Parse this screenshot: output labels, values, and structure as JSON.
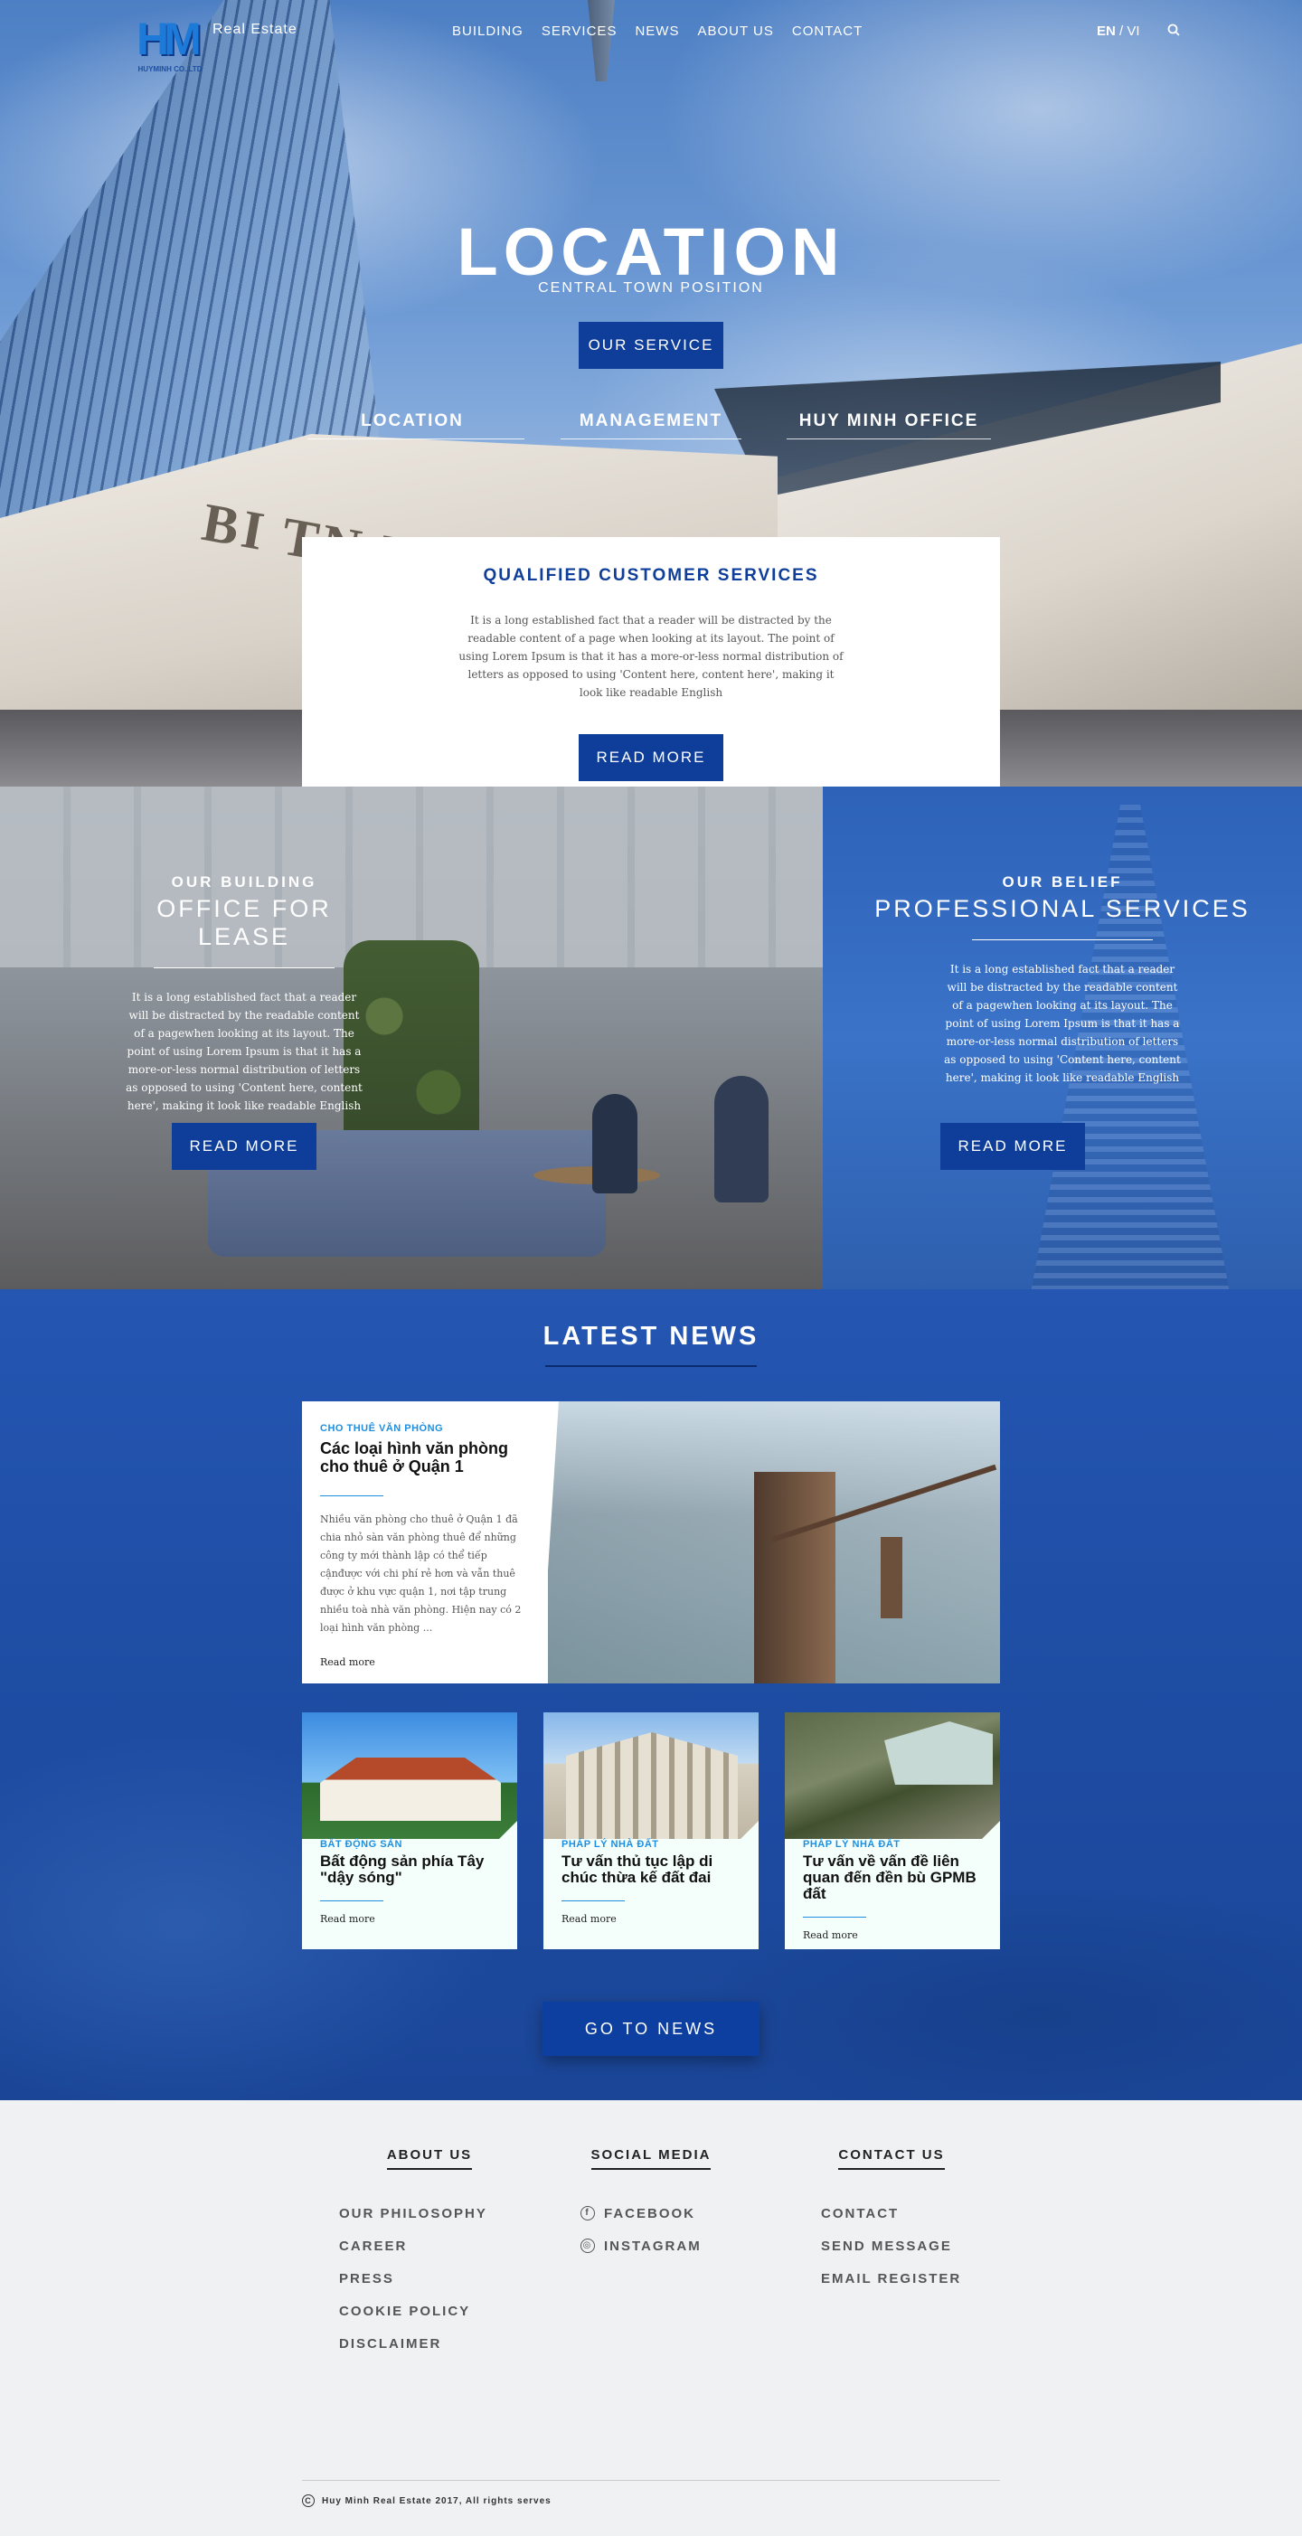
{
  "header": {
    "brand": "Real Estate",
    "logo_text": "HUYMINH CO.,LTD",
    "nav": [
      "BUILDING",
      "SERVICES",
      "NEWS",
      "ABOUT US",
      "CONTACT"
    ],
    "lang_en": "EN",
    "lang_sep": " / ",
    "lang_vi": "VI"
  },
  "hero": {
    "title": "LOCATION",
    "subtitle": "CENTRAL TOWN POSITION",
    "button": "OUR SERVICE",
    "tabs": [
      "LOCATION",
      "MANAGEMENT",
      "HUY MINH OFFICE"
    ],
    "building_sign": "BI TN TOV"
  },
  "qualified": {
    "title": "QUALIFIED CUSTOMER SERVICES",
    "body": "It is a long established fact that a reader will be distracted by the readable content of a page when looking at its layout. The point of using Lorem Ipsum is that it has a more-or-less normal distribution of letters as opposed to using 'Content here, content here', making it look like readable English",
    "button": "READ MORE"
  },
  "features": {
    "left": {
      "kicker": "OUR BUILDING",
      "title": "OFFICE FOR LEASE",
      "body": "It is a long established fact that a reader will be distracted by the readable content of a pagewhen looking at its layout. The point of using Lorem Ipsum is that it has a more-or-less normal distribution of letters as opposed to using 'Content here, content here', making it look like readable English",
      "button": "READ MORE"
    },
    "right": {
      "kicker": "OUR BELIEF",
      "title": "PROFESSIONAL SERVICES",
      "body": "It is a long established fact that a reader will be distracted by the readable content of a pagewhen looking at its layout. The point of using Lorem Ipsum is that it has a more-or-less normal distribution of letters as opposed to using 'Content here, content here', making it look like readable English",
      "button": "READ MORE"
    }
  },
  "news": {
    "title": "LATEST NEWS",
    "featured": {
      "category": "CHO THUÊ VĂN PHÒNG",
      "headline": "Các loại hình văn phòng cho thuê ở Quận 1",
      "excerpt": "Nhiều văn phòng cho thuê ở Quận 1 đã chia nhỏ sàn văn phòng thuê để những công ty mới thành lập có thể tiếp cậnđược với chi phí rẻ hơn và vẫn thuê được ở khu vực quận 1, nơi tập trung nhiều toà nhà văn phòng. Hiện nay có 2 loại hình văn phòng ...",
      "read_more": "Read more"
    },
    "cards": [
      {
        "category": "BẤT ĐỘNG SẢN",
        "headline": "Bất động sản phía Tây \"dậy sóng\"",
        "read_more": "Read more"
      },
      {
        "category": "PHÁP LÝ NHÀ ĐẤT",
        "headline": "Tư vấn thủ tục lập di chúc thừa kế đất đai",
        "read_more": "Read more"
      },
      {
        "category": "PHÁP LÝ NHÀ ĐẤT",
        "headline": "Tư vấn về vấn đề liên quan đến đền bù GPMB đất",
        "read_more": "Read more"
      }
    ],
    "button": "GO TO NEWS"
  },
  "footer": {
    "about": {
      "title": "ABOUT US",
      "items": [
        "OUR PHILOSOPHY",
        "CAREER",
        "PRESS",
        "COOKIE POLICY",
        "DISCLAIMER"
      ]
    },
    "social": {
      "title": "SOCIAL MEDIA",
      "items": [
        "FACEBOOK",
        "INSTAGRAM"
      ],
      "icons": [
        "facebook-icon",
        "instagram-icon"
      ]
    },
    "contact": {
      "title": "CONTACT US",
      "items": [
        "CONTACT",
        "SEND MESSAGE",
        "EMAIL REGISTER"
      ]
    },
    "copyright": "Huy Minh Real Estate 2017, All rights serves"
  },
  "colors": {
    "primary_blue": "#0e3e9a",
    "accent_blue": "#1e8fe0",
    "news_bg": "#1f4ea6",
    "footer_bg": "#f0f1f3"
  }
}
